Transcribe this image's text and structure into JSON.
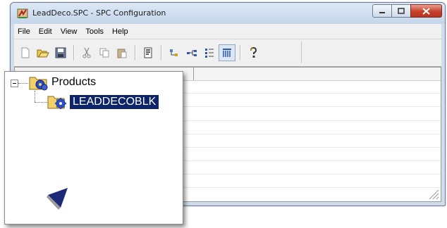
{
  "window": {
    "title": "LeadDeco.SPC - SPC Configuration",
    "app_icon": "spc-app-icon",
    "controls": [
      "minimize-icon",
      "maximize-icon",
      "close-icon"
    ]
  },
  "menu": {
    "items": [
      "File",
      "Edit",
      "View",
      "Tools",
      "Help"
    ]
  },
  "toolbar": {
    "buttons": [
      "new-icon",
      "open-icon",
      "save-icon",
      "cut-icon",
      "copy-icon",
      "paste-icon",
      "properties-icon",
      "tree-icon",
      "link-icon",
      "list-icon",
      "columns-icon",
      "help-icon"
    ],
    "pressed": "columns-icon"
  },
  "tree": {
    "root": {
      "label": "Products",
      "expanded": true,
      "icon": "products-folder-icon"
    },
    "children": [
      {
        "label": "LEADDECOBLK",
        "selected": true,
        "icon": "product-gear-icon"
      }
    ]
  },
  "colors": {
    "selection": "#0b246a",
    "titlebar": "#cfdcec",
    "close_button": "#c6402b"
  }
}
